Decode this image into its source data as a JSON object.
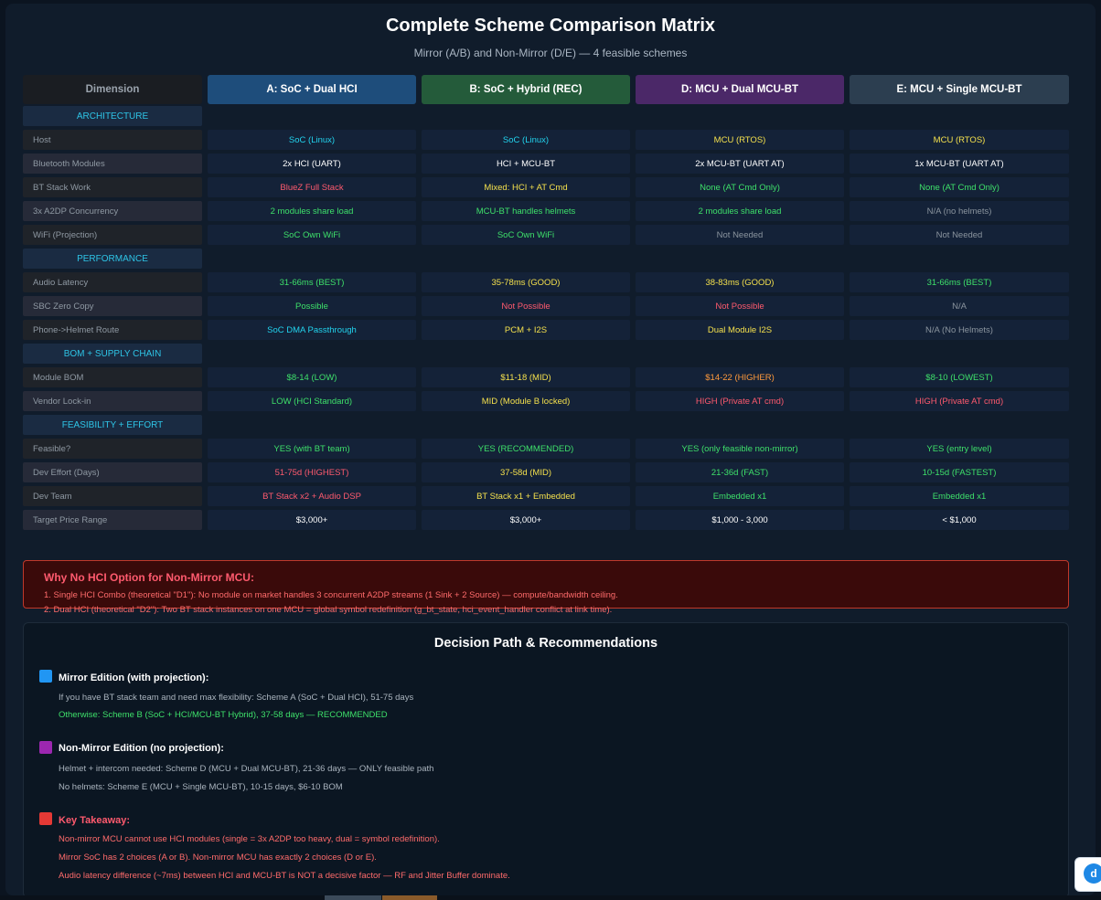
{
  "header": {
    "title": "Complete Scheme Comparison Matrix",
    "subtitle": "Mirror (A/B) and Non-Mirror (D/E) — 4 feasible schemes"
  },
  "table": {
    "columns": [
      "Dimension",
      "A: SoC + Dual HCI",
      "B: SoC + Hybrid (REC)",
      "D: MCU + Dual MCU-BT",
      "E: MCU + Single MCU-BT"
    ],
    "sections": {
      "architecture": "ARCHITECTURE",
      "performance": "PERFORMANCE",
      "bom": "BOM + SUPPLY CHAIN",
      "feasibility": "FEASIBILITY + EFFORT"
    },
    "rows": {
      "host": {
        "label": "Host",
        "a": "SoC (Linux)",
        "b": "SoC (Linux)",
        "d": "MCU (RTOS)",
        "e": "MCU (RTOS)"
      },
      "bt_modules": {
        "label": "Bluetooth Modules",
        "a": "2x HCI (UART)",
        "b": "HCI + MCU-BT",
        "d": "2x MCU-BT (UART AT)",
        "e": "1x MCU-BT (UART AT)"
      },
      "bt_stack": {
        "label": "BT Stack Work",
        "a": "BlueZ Full Stack",
        "b": "Mixed: HCI + AT Cmd",
        "d": "None (AT Cmd Only)",
        "e": "None (AT Cmd Only)"
      },
      "a2dp": {
        "label": "3x A2DP Concurrency",
        "a": "2 modules share load",
        "b": "MCU-BT handles helmets",
        "d": "2 modules share load",
        "e": "N/A (no helmets)"
      },
      "wifi": {
        "label": "WiFi (Projection)",
        "a": "SoC Own WiFi",
        "b": "SoC Own WiFi",
        "d": "Not Needed",
        "e": "Not Needed"
      },
      "latency": {
        "label": "Audio Latency",
        "a": "31-66ms (BEST)",
        "b": "35-78ms (GOOD)",
        "d": "38-83ms (GOOD)",
        "e": "31-66ms (BEST)"
      },
      "sbc": {
        "label": "SBC Zero Copy",
        "a": "Possible",
        "b": "Not Possible",
        "d": "Not Possible",
        "e": "N/A"
      },
      "route": {
        "label": "Phone->Helmet Route",
        "a": "SoC DMA Passthrough",
        "b": "PCM + I2S",
        "d": "Dual Module I2S",
        "e": "N/A (No Helmets)"
      },
      "module_bom": {
        "label": "Module BOM",
        "a": "$8-14 (LOW)",
        "b": "$11-18 (MID)",
        "d": "$14-22 (HIGHER)",
        "e": "$8-10 (LOWEST)"
      },
      "lockin": {
        "label": "Vendor Lock-in",
        "a": "LOW (HCI Standard)",
        "b": "MID (Module B locked)",
        "d": "HIGH (Private AT cmd)",
        "e": "HIGH (Private AT cmd)"
      },
      "feasible": {
        "label": "Feasible?",
        "a": "YES (with BT team)",
        "b": "YES (RECOMMENDED)",
        "d": "YES (only feasible non-mirror)",
        "e": "YES (entry level)"
      },
      "effort": {
        "label": "Dev Effort (Days)",
        "a": "51-75d (HIGHEST)",
        "b": "37-58d (MID)",
        "d": "21-36d (FAST)",
        "e": "10-15d (FASTEST)"
      },
      "team": {
        "label": "Dev Team",
        "a": "BT Stack x2 + Audio DSP",
        "b": "BT Stack x1 + Embedded",
        "d": "Embedded x1",
        "e": "Embedded x1"
      },
      "price": {
        "label": "Target Price Range",
        "a": "$3,000+",
        "b": "$3,000+",
        "d": "$1,000 - 3,000",
        "e": "< $1,000"
      }
    }
  },
  "warning": {
    "title": "Why No HCI Option for Non-Mirror MCU:",
    "line1": "1. Single HCI Combo (theoretical \"D1\"): No module on market handles 3 concurrent A2DP streams (1 Sink + 2 Source) — compute/bandwidth ceiling.",
    "line2": "2. Dual HCI (theoretical \"D2\"): Two BT stack instances on one MCU = global symbol redefinition (g_bt_state, hci_event_handler conflict at link time)."
  },
  "decision": {
    "title": "Decision Path & Recommendations",
    "mirror": {
      "heading": "Mirror Edition (with projection):",
      "line1": "If you have BT stack team and need max flexibility: Scheme A (SoC + Dual HCI), 51-75 days",
      "line2": "Otherwise: Scheme B (SoC + HCI/MCU-BT Hybrid), 37-58 days — RECOMMENDED"
    },
    "nonmirror": {
      "heading": "Non-Mirror Edition (no projection):",
      "line1": "Helmet + intercom needed: Scheme D (MCU + Dual MCU-BT), 21-36 days — ONLY feasible path",
      "line2": "No helmets: Scheme E (MCU + Single MCU-BT), 10-15 days, $6-10 BOM"
    },
    "takeaway": {
      "heading": "Key Takeaway:",
      "line1": "Non-mirror MCU cannot use HCI modules (single = 3x A2DP too heavy, dual = symbol redefinition).",
      "line2": "Mirror SoC has 2 choices (A or B). Non-mirror MCU has exactly 2 choices (D or E).",
      "line3": "Audio latency difference (~7ms) between HCI and MCU-BT is NOT a decisive factor — RF and Jitter Buffer dominate."
    }
  },
  "widget": {
    "glyph": "d"
  },
  "colors": {
    "scheme_a": "#1e4d7b",
    "scheme_b": "#245b3a",
    "scheme_d": "#4b2868",
    "scheme_e": "#2c3e50",
    "mirror_square": "#2196f3",
    "nonmirror_square": "#9c27b0",
    "takeaway_square": "#e53935"
  }
}
